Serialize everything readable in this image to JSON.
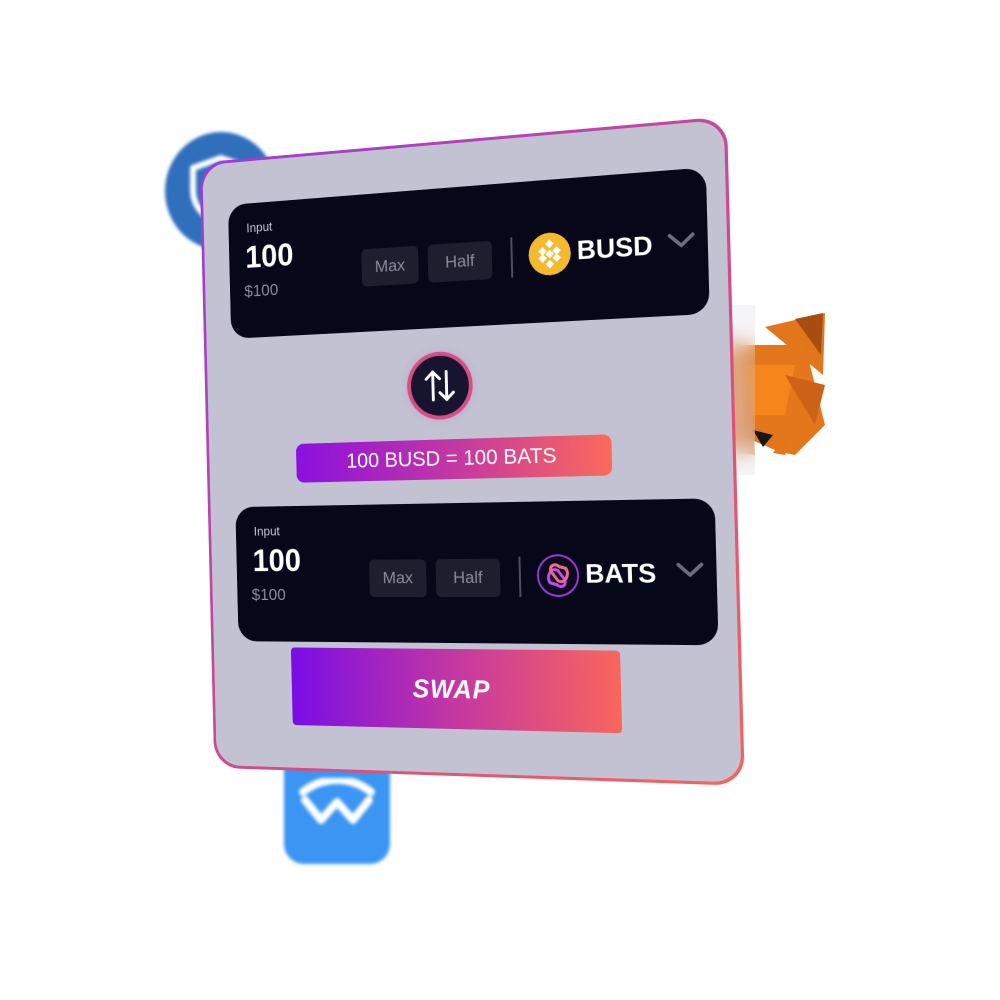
{
  "from": {
    "label": "Input",
    "amount": "100",
    "usd": "$100",
    "max_label": "Max",
    "half_label": "Half",
    "token": "BUSD",
    "token_icon": "busd-coin-icon",
    "token_color": "#f3ba2f"
  },
  "to": {
    "label": "Input",
    "amount": "100",
    "usd": "$100",
    "max_label": "Max",
    "half_label": "Half",
    "token": "BATS",
    "token_icon": "bats-logo-icon"
  },
  "rate_text": "100 BUSD = 100 BATS",
  "swap_label": "SWAP",
  "colors": {
    "gradient_start": "#7a0ce6",
    "gradient_end": "#f8665c",
    "row_bg": "#07071a",
    "card_bg": "#c2c2d3"
  },
  "background_icons": [
    "trust-wallet-shield-icon",
    "metamask-fox-icon",
    "walletconnect-icon"
  ]
}
